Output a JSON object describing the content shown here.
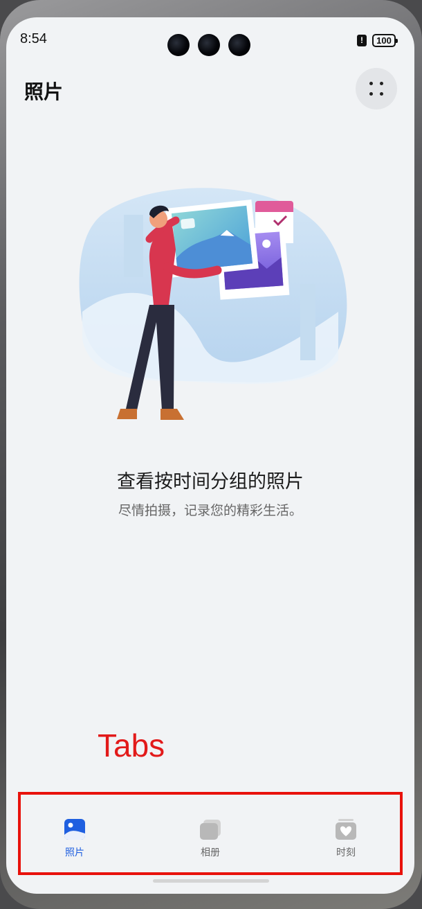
{
  "status_bar": {
    "time": "8:54",
    "battery": "100",
    "alert": "!"
  },
  "header": {
    "title": "照片",
    "more_icon": "more-dots-icon"
  },
  "empty_state": {
    "title": "查看按时间分组的照片",
    "subtitle": "尽情拍摄，记录您的精彩生活。"
  },
  "annotation": {
    "label": "Tabs",
    "color": "#e21a1a"
  },
  "tabs": [
    {
      "label": "照片",
      "icon": "photo-icon",
      "selected": true
    },
    {
      "label": "相册",
      "icon": "album-icon",
      "selected": false
    },
    {
      "label": "时刻",
      "icon": "moment-heart-icon",
      "selected": false
    }
  ],
  "colors": {
    "accent": "#1f5fe0",
    "background": "#f1f3f5",
    "inactive": "#b8b8b8"
  }
}
